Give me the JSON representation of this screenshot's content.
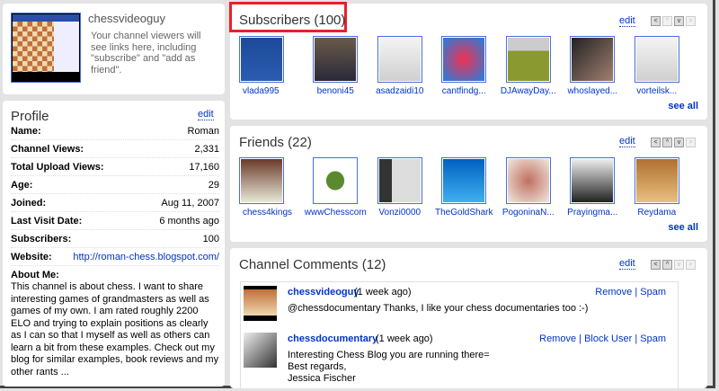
{
  "channel": {
    "name": "chessvideoguy",
    "info": "Your channel viewers will see links here, including \"subscribe\" and \"add as friend\"."
  },
  "profile": {
    "title": "Profile",
    "edit": "edit",
    "rows": [
      {
        "label": "Name:",
        "value": "Roman"
      },
      {
        "label": "Channel Views:",
        "value": "2,331"
      },
      {
        "label": "Total Upload Views:",
        "value": "17,160"
      },
      {
        "label": "Age:",
        "value": "29"
      },
      {
        "label": "Joined:",
        "value": "Aug 11, 2007"
      },
      {
        "label": "Last Visit Date:",
        "value": "6 months ago"
      },
      {
        "label": "Subscribers:",
        "value": "100"
      },
      {
        "label": "Website:",
        "value": "http://roman-chess.blogspot.com/"
      }
    ],
    "about_label": "About Me:",
    "about": "This channel is about chess. I want to share interesting games of grandmasters as well as games of my own. I am rated roughly 2200 ELO and trying to explain positions as clearly as I can so that I myself as well as others can learn a bit from these examples. Check out my blog for similar examples, book reviews and my other rants ..."
  },
  "subscribers": {
    "title": "Subscribers (100)",
    "edit": "edit",
    "see_all": "see all",
    "highlight_color": "#e8202a",
    "users": [
      "vlada995",
      "benoni45",
      "asadzaidi10",
      "cantfindg...",
      "DJAwayDay...",
      "whoslayed...",
      "vorteilsk..."
    ]
  },
  "friends": {
    "title": "Friends (22)",
    "edit": "edit",
    "see_all": "see all",
    "users": [
      "chess4kings",
      "wwwChesscom",
      "Vonzi0000",
      "TheGoldShark",
      "PogoninaN...",
      "Prayingma...",
      "Reydama"
    ]
  },
  "comments": {
    "title": "Channel Comments (12)",
    "edit": "edit",
    "items": [
      {
        "author": "chessvideoguy",
        "time": "(1 week ago)",
        "text": "@chessdocumentary Thanks, I like your chess documentaries too :-)",
        "actions": [
          "Remove",
          "Spam"
        ]
      },
      {
        "author": "chessdocumentary",
        "time": "(1 week ago)",
        "text": "Interesting Chess Blog you are running there=\nBest regards,\nJessica Fischer",
        "actions": [
          "Remove",
          "Block User",
          "Spam"
        ]
      }
    ]
  }
}
